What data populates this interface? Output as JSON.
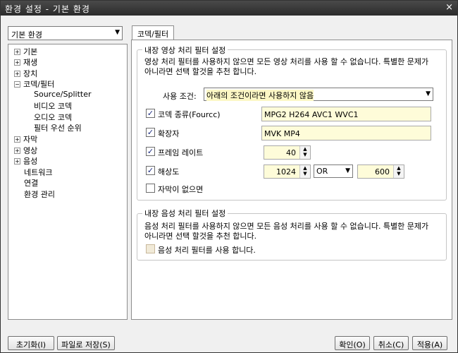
{
  "window": {
    "title": "환경 설정 - 기본 환경",
    "close_icon": "×"
  },
  "preset": {
    "value": "기본 환경"
  },
  "tree": [
    {
      "label": "기본",
      "expander": "+"
    },
    {
      "label": "재생",
      "expander": "+"
    },
    {
      "label": "장치",
      "expander": "+"
    },
    {
      "label": "코덱/필터",
      "expander": "−"
    },
    {
      "label": "Source/Splitter",
      "expander": ""
    },
    {
      "label": "비디오 코덱",
      "expander": ""
    },
    {
      "label": "오디오 코덱",
      "expander": ""
    },
    {
      "label": "필터 우선 순위",
      "expander": ""
    },
    {
      "label": "자막",
      "expander": "+"
    },
    {
      "label": "영상",
      "expander": "+"
    },
    {
      "label": "음성",
      "expander": "+"
    },
    {
      "label": "네트워크",
      "expander": ""
    },
    {
      "label": "연결",
      "expander": ""
    },
    {
      "label": "환경 관리",
      "expander": ""
    }
  ],
  "tab": {
    "label": "코덱/필터"
  },
  "video_group": {
    "title": "내장 영상 처리 필터 설정",
    "desc": "영상 처리 필터를 사용하지 않으면 모든 영상 처리를 사용 할 수 없습니다. 특별한 문제가 아니라면 선택 할것을 추천 합니다.",
    "condition_label": "사용 조건:",
    "condition_value": "아래의 조건이라면 사용하지 않음",
    "fourcc": {
      "label": "코덱 종류(Fourcc)",
      "checked": true,
      "value": "MPG2 H264 AVC1 WVC1"
    },
    "ext": {
      "label": "확장자",
      "checked": true,
      "value": "MVK MP4"
    },
    "framerate": {
      "label": "프레임 레이트",
      "checked": true,
      "value": "40"
    },
    "resolution": {
      "label": "해상도",
      "checked": true,
      "width": "1024",
      "op": "OR",
      "height": "600"
    },
    "nosub": {
      "label": "자막이 없으면",
      "checked": false
    }
  },
  "audio_group": {
    "title": "내장 음성 처리 필터 설정",
    "desc": "음성 처리 필터를 사용하지 않으면 모든 음성 처리를 사용 할 수 없습니다. 특별한 문제가 아니라면 선택 할것을 추천 합니다.",
    "use": {
      "label": "음성 처리 필터를 사용 합니다.",
      "checked": false
    }
  },
  "buttons": {
    "reset": "초기화(I)",
    "save_file": "파일로 저장(S)",
    "ok": "확인(O)",
    "cancel": "취소(C)",
    "apply": "적용(A)"
  }
}
